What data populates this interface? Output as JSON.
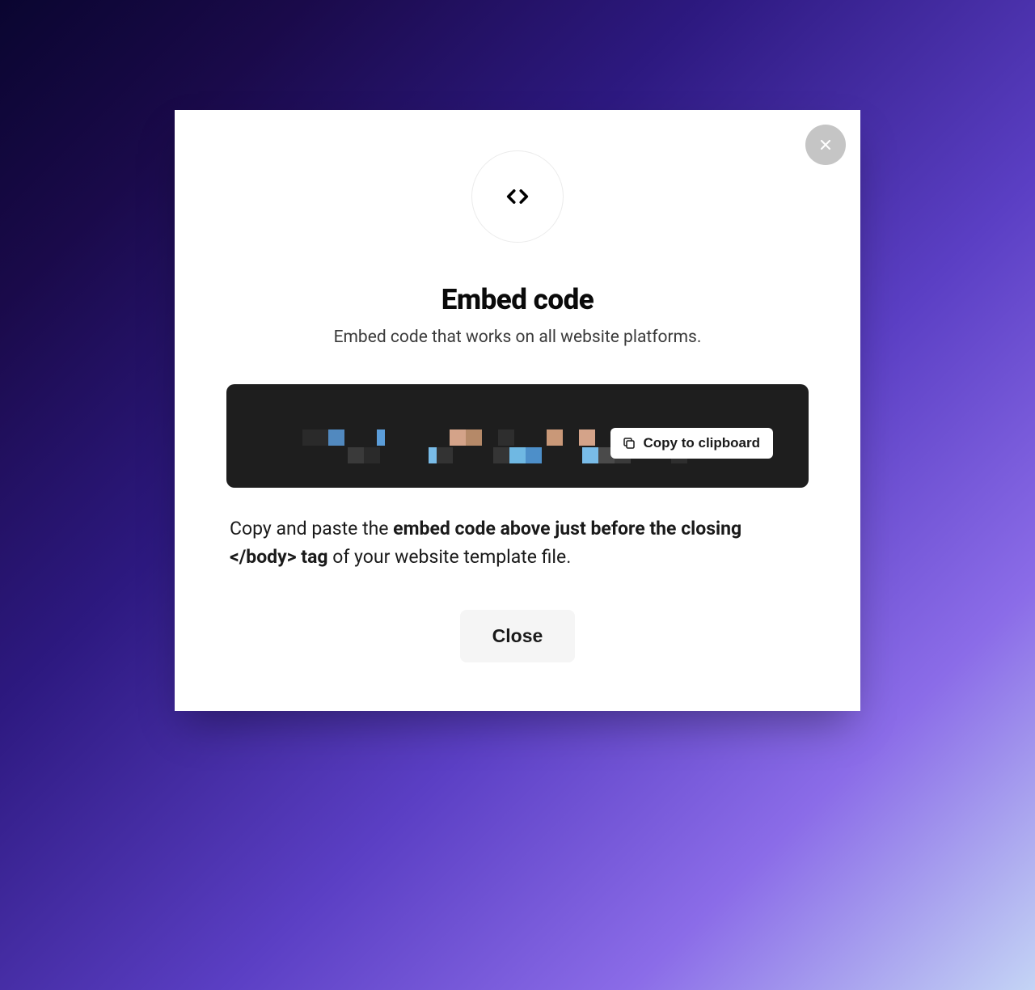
{
  "modal": {
    "title": "Embed code",
    "subtitle": "Embed code that works on all website platforms.",
    "copy_button_label": "Copy to clipboard",
    "instruction_prefix": "Copy and paste the ",
    "instruction_bold": "embed code above just before the closing </body> tag",
    "instruction_suffix": " of your website template file.",
    "close_button_label": "Close"
  }
}
